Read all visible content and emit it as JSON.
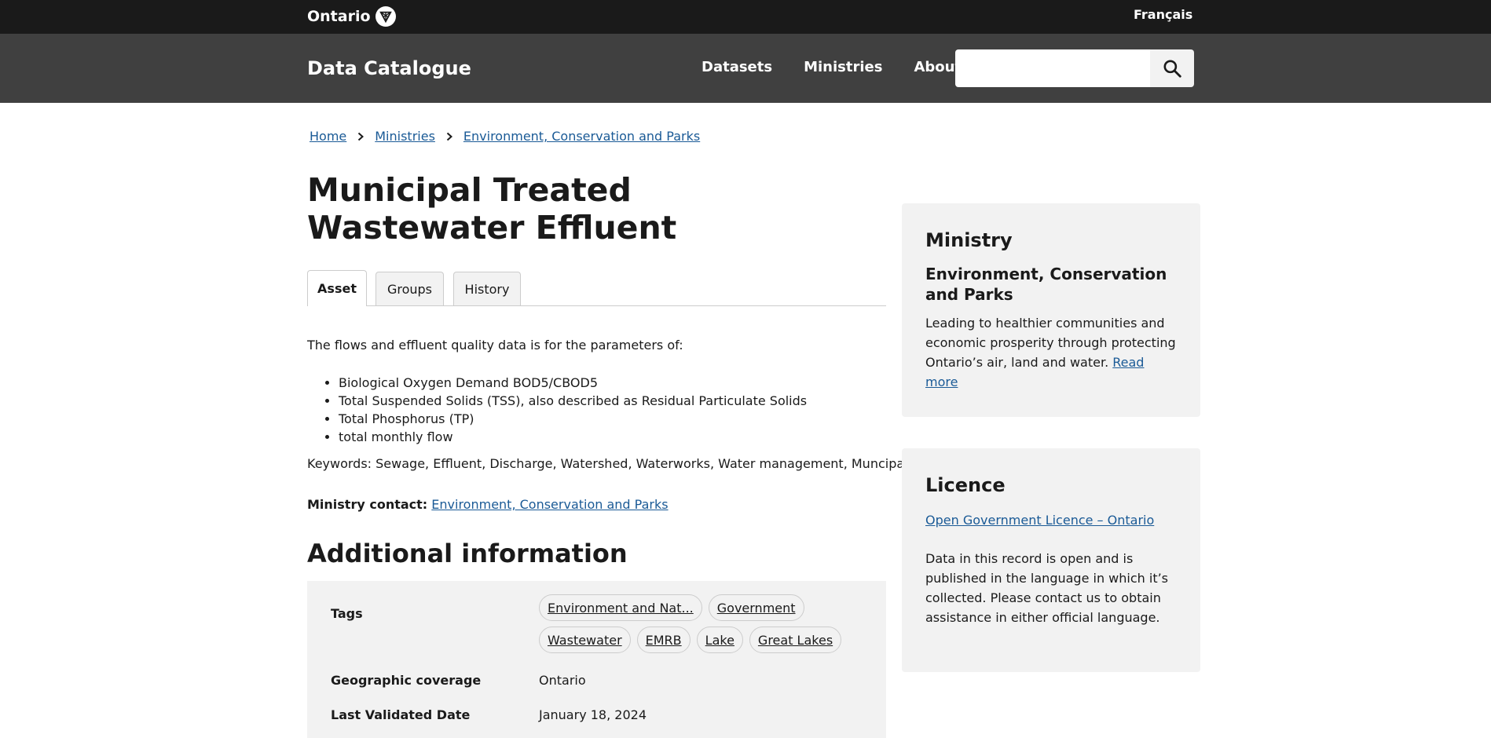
{
  "header": {
    "brand": "Ontario",
    "language_link": "Français",
    "site_title": "Data Catalogue",
    "nav": [
      "Datasets",
      "Ministries",
      "About"
    ],
    "search_placeholder": ""
  },
  "breadcrumb": [
    "Home",
    "Ministries",
    "Environment, Conservation and Parks"
  ],
  "page": {
    "title": "Municipal Treated Wastewater Effluent",
    "tabs": [
      "Asset",
      "Groups",
      "History"
    ],
    "description_intro": "The flows and effluent quality data is for the parameters of:",
    "parameters": [
      "Biological Oxygen Demand BOD5/CBOD5",
      "Total Suspended Solids (TSS), also described as Residual Particulate Solids",
      "Total Phosphorus (TP)",
      "total monthly flow"
    ],
    "keywords": "Keywords: Sewage, Effluent, Discharge, Watershed, Waterworks, Water management, Muncipality",
    "contact_label": "Ministry contact:",
    "contact_link": "Environment, Conservation and Parks",
    "additional_heading": "Additional information"
  },
  "info": {
    "tags_label": "Tags",
    "tags": [
      "Environment and Nat...",
      "Government",
      "Wastewater",
      "EMRB",
      "Lake",
      "Great Lakes"
    ],
    "geo_label": "Geographic coverage",
    "geo_value": "Ontario",
    "validated_label": "Last Validated Date",
    "validated_value": "January 18, 2024"
  },
  "ministry_card": {
    "heading": "Ministry",
    "name": "Environment, Conservation and Parks",
    "text": "Leading to healthier communities and economic prosperity through protecting Ontario’s air, land and water.",
    "read_more": "Read more"
  },
  "licence_card": {
    "heading": "Licence",
    "link": "Open Government Licence – Ontario",
    "text": "Data in this record is open and is published in the language in which it’s collected. Please contact us to obtain assistance in either official language."
  },
  "colors": {
    "topbar": "#1a1a1a",
    "navbar": "#404040",
    "link": "#1a5a96",
    "panel": "#f2f2f2"
  }
}
